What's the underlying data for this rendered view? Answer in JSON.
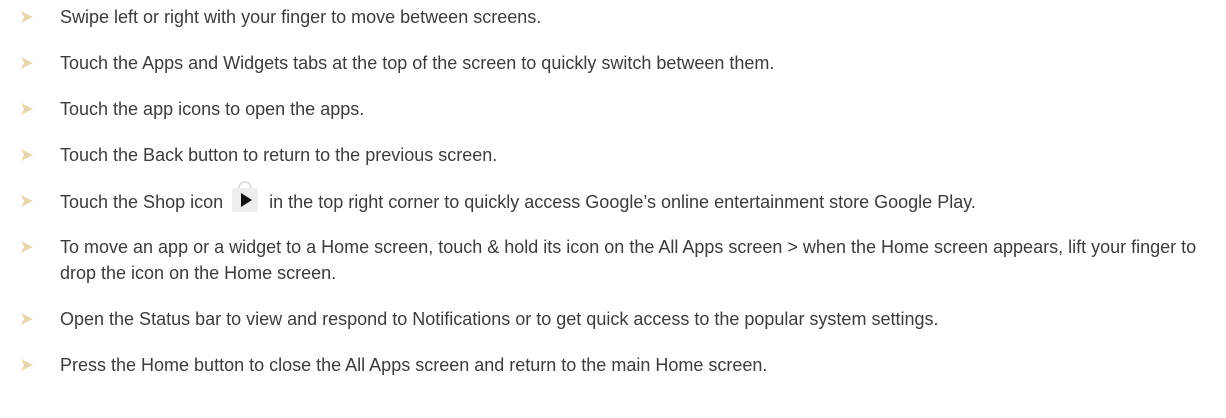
{
  "bullet_icon": "arrow-bullet-icon",
  "bullet_color": "#e8d6ad",
  "text_color": "#3c3c3c",
  "items": [
    {
      "text": "Swipe left or right with your finger to move between screens."
    },
    {
      "text": "Touch the Apps and Widgets tabs at the top of the screen to quickly switch between them."
    },
    {
      "text": "Touch the app icons to open the apps."
    },
    {
      "text": "Touch the Back button to return to the previous screen."
    },
    {
      "text_before": "Touch the Shop icon",
      "icon": "shop-bag-icon",
      "text_after": "in the top right corner to quickly access Google’s online entertainment store Google Play."
    },
    {
      "text": "To move an app or a widget to a Home screen, touch & hold its icon on the All Apps screen > when the Home screen appears, lift your finger to drop the icon on the Home screen."
    },
    {
      "text": "Open the Status bar to view and respond to Notifications or to get quick access to the popular system settings."
    },
    {
      "text": "Press the Home button to close the All Apps screen and return to the main Home screen."
    }
  ]
}
